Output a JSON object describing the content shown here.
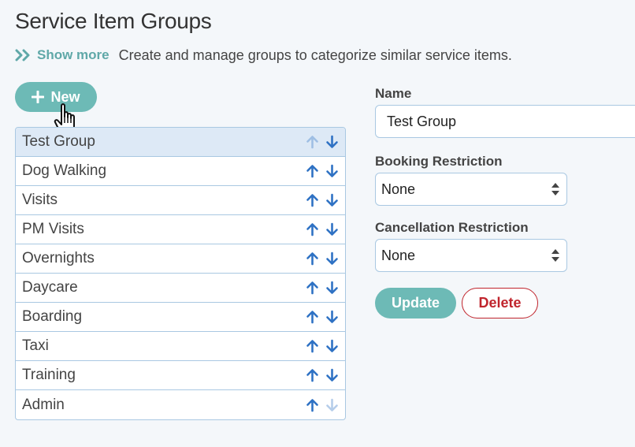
{
  "page": {
    "title": "Service Item Groups",
    "show_more_label": "Show more",
    "description": "Create and manage groups to categorize similar service items."
  },
  "toolbar": {
    "new_label": "New"
  },
  "groups": [
    {
      "label": "Test Group",
      "selected": true,
      "up_enabled": false,
      "down_enabled": true
    },
    {
      "label": "Dog Walking",
      "selected": false,
      "up_enabled": true,
      "down_enabled": true
    },
    {
      "label": "Visits",
      "selected": false,
      "up_enabled": true,
      "down_enabled": true
    },
    {
      "label": "PM Visits",
      "selected": false,
      "up_enabled": true,
      "down_enabled": true
    },
    {
      "label": "Overnights",
      "selected": false,
      "up_enabled": true,
      "down_enabled": true
    },
    {
      "label": "Daycare",
      "selected": false,
      "up_enabled": true,
      "down_enabled": true
    },
    {
      "label": "Boarding",
      "selected": false,
      "up_enabled": true,
      "down_enabled": true
    },
    {
      "label": "Taxi",
      "selected": false,
      "up_enabled": true,
      "down_enabled": true
    },
    {
      "label": "Training",
      "selected": false,
      "up_enabled": true,
      "down_enabled": true
    },
    {
      "label": "Admin",
      "selected": false,
      "up_enabled": true,
      "down_enabled": false
    }
  ],
  "form": {
    "name_label": "Name",
    "name_value": "Test Group",
    "booking_label": "Booking Restriction",
    "booking_value": "None",
    "cancellation_label": "Cancellation Restriction",
    "cancellation_value": "None",
    "update_label": "Update",
    "delete_label": "Delete"
  },
  "icons": {
    "show_more": "double-chevron-right-icon",
    "new": "plus-icon",
    "cursor": "hand-pointer-icon",
    "move_up": "arrow-up-icon",
    "move_down": "arrow-down-icon",
    "select": "updown-caret-icon"
  },
  "colors": {
    "accent": "#6dbab6",
    "arrow": "#2f72c4",
    "danger": "#c0252d",
    "border": "#a9c8e2",
    "selected_row": "#dde9f6"
  }
}
